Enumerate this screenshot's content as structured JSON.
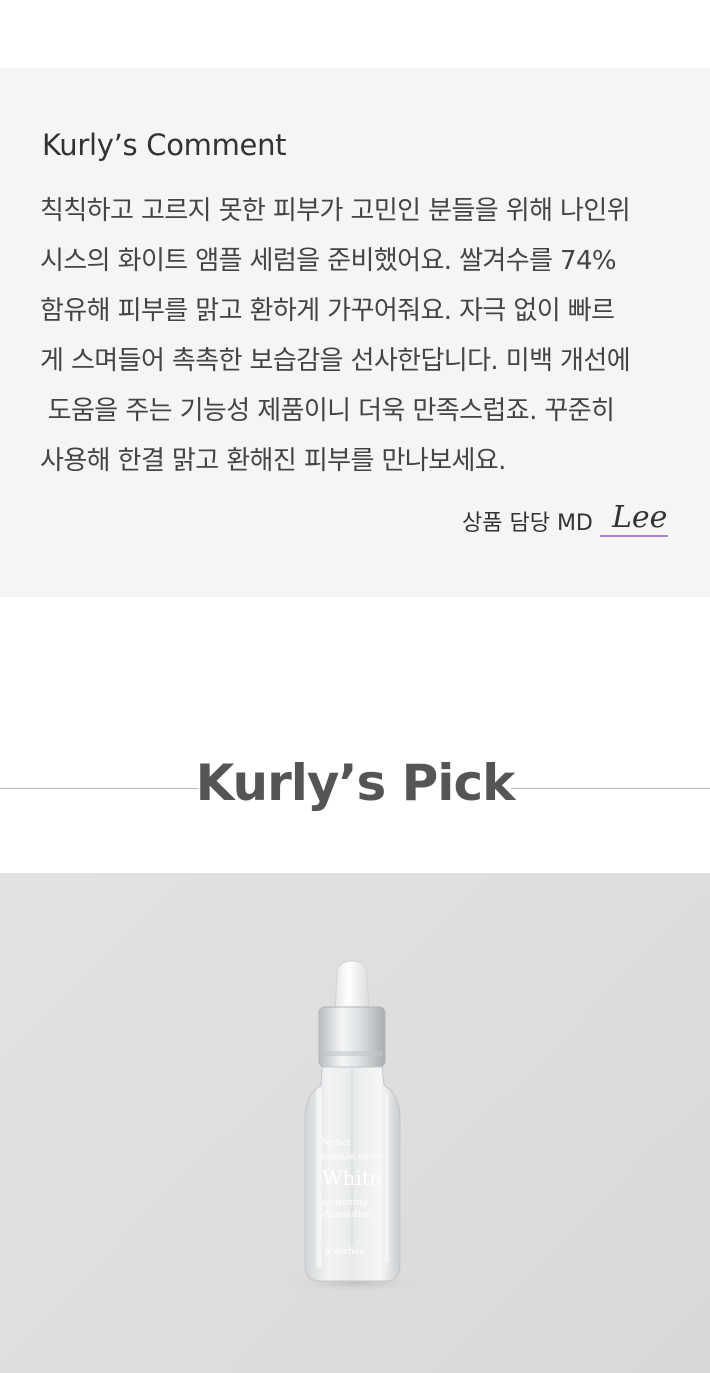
{
  "comment": {
    "title": "Kurly’s Comment",
    "lines": [
      "칙칙하고 고르지 못한 피부가 고민인 분들을 위해 나인위",
      "시스의 화이트 앰플 세럼을 준비했어요. 쌀겨수를 74%",
      "함유해 피부를 맑고 환하게 가꾸어줘요. 자극 없이 빠르",
      "게 스며들어 촉촉한 보습감을 선사한답니다. 미백 개선에",
      " 도움을 주는 기능성 제품이니 더욱 만족스럽죠. 꾸준히",
      "사용해 한결 맑고 환해진 피부를 만나보세요."
    ],
    "md_label": "상품 담당 MD",
    "signature": "Lee"
  },
  "pick": {
    "title": "Kurly’s Pick"
  },
  "product": {
    "label_line1": "Perfect",
    "label_line2": "ampoule serum",
    "label_brand": "White",
    "label_line3": "whitening",
    "label_line4": "dissolution",
    "logo_text": "9 wishes"
  }
}
